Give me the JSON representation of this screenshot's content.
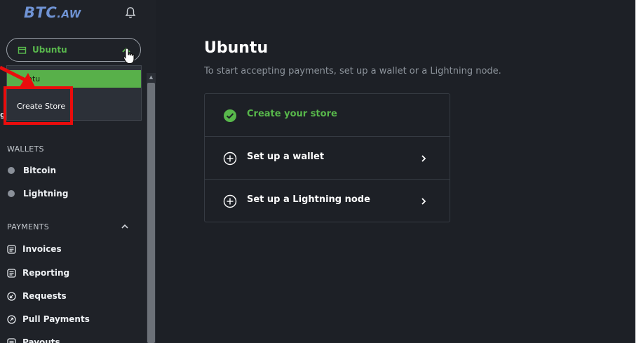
{
  "app": {
    "logo_main": "BTC",
    "logo_sub": ".AW"
  },
  "store_selector": {
    "label": "Ubuntu"
  },
  "dropdown": {
    "selected": "untu",
    "create_store": "Create Store",
    "partial_hidden": "g"
  },
  "sidebar": {
    "wallets_title": "WALLETS",
    "wallets": [
      {
        "label": "Bitcoin"
      },
      {
        "label": "Lightning"
      }
    ],
    "payments_title": "PAYMENTS",
    "payments": [
      {
        "label": "Invoices",
        "icon": "document-icon"
      },
      {
        "label": "Reporting",
        "icon": "document-icon"
      },
      {
        "label": "Requests",
        "icon": "request-icon"
      },
      {
        "label": "Pull Payments",
        "icon": "pull-payments-icon"
      },
      {
        "label": "Payouts",
        "icon": "document-icon"
      }
    ]
  },
  "main": {
    "title": "Ubuntu",
    "subtitle": "To start accepting payments, set up a wallet or a Lightning node.",
    "steps": [
      {
        "label": "Create your store",
        "done": true
      },
      {
        "label": "Set up a wallet",
        "done": false
      },
      {
        "label": "Set up a Lightning node",
        "done": false
      }
    ]
  },
  "colors": {
    "accent_green": "#58b84b",
    "sidebar_bg": "#1f2228",
    "main_bg": "#1d2026",
    "highlight_red": "#ea0c0c",
    "logo_blue": "#6f93d4"
  }
}
